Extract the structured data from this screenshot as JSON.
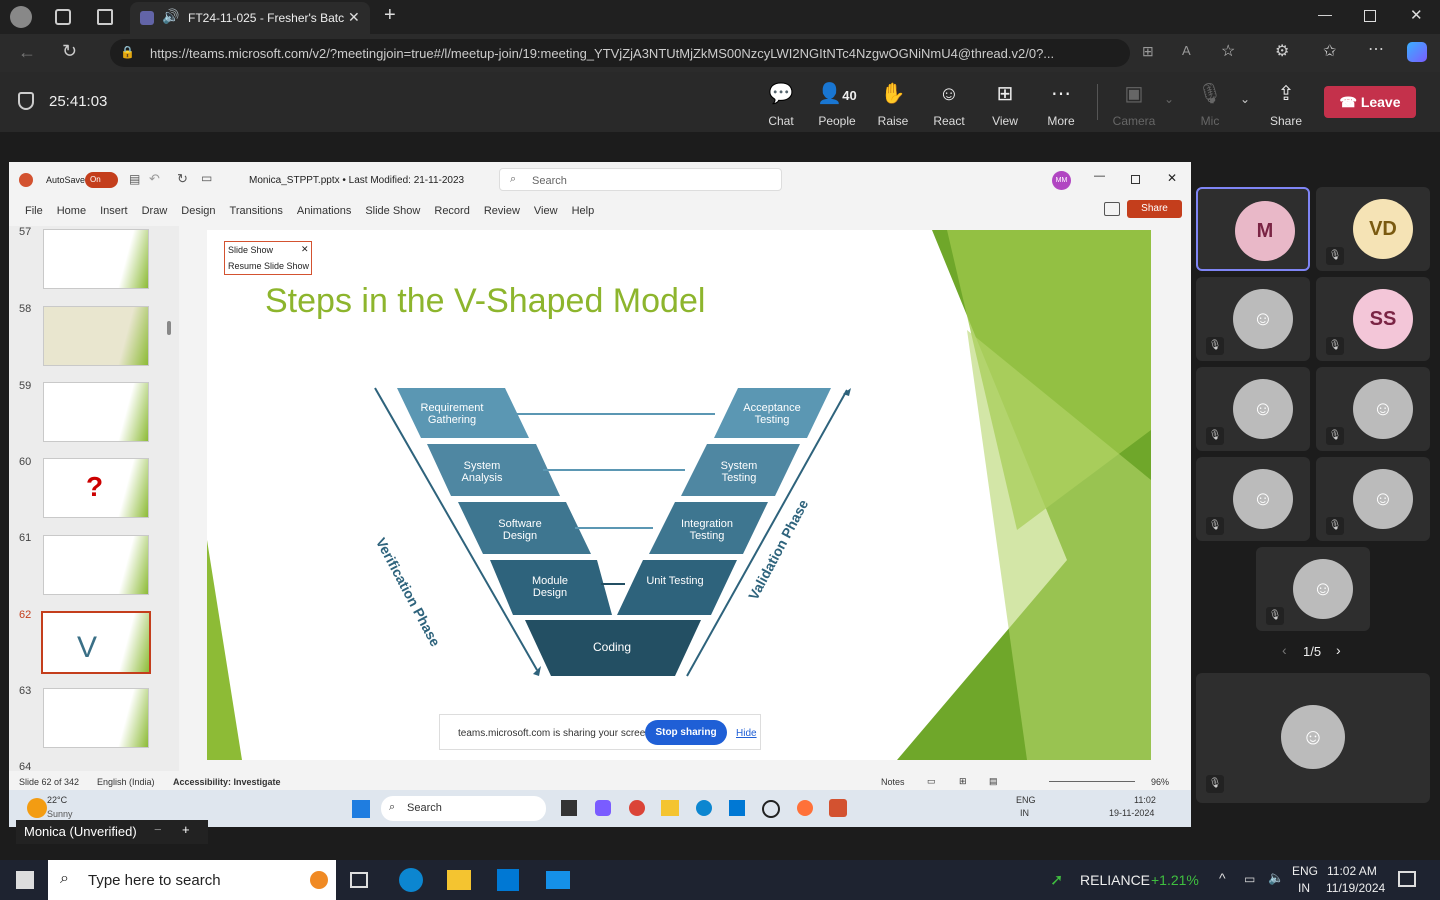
{
  "browser": {
    "tab_title": "FT24-11-025 - Fresher's Batc",
    "url": "https://teams.microsoft.com/v2/?meetingjoin=true#/l/meetup-join/19:meeting_YTVjZjA3NTUtMjZkMS00NzcyLWI2NGItNTc4NzgwOGNiNmU4@thread.v2/0?..."
  },
  "teams": {
    "timer": "25:41:03",
    "people_count": "40",
    "buttons": [
      "Chat",
      "People",
      "Raise",
      "React",
      "View",
      "More",
      "Camera",
      "Mic",
      "Share"
    ],
    "leave": "Leave"
  },
  "ppt": {
    "autosave": "AutoSave",
    "autosave_state": "On",
    "file": "Monica_STPPT.pptx • Last Modified: 21-11-2023",
    "search": "Search",
    "avatar": "MM",
    "share": "Share",
    "menu": [
      "File",
      "Home",
      "Insert",
      "Draw",
      "Design",
      "Transitions",
      "Animations",
      "Slide Show",
      "Record",
      "Review",
      "View",
      "Help"
    ],
    "thumb_numbers": [
      "57",
      "58",
      "59",
      "60",
      "61",
      "62",
      "63",
      "64"
    ],
    "slideshow_popup": {
      "title": "Slide Show",
      "resume": "Resume Slide Show"
    },
    "slide_title": "Steps in the V-Shaped Model",
    "left_levels": [
      "Requirement Gathering",
      "System Analysis",
      "Software Design",
      "Module Design"
    ],
    "right_levels": [
      "Acceptance Testing",
      "System Testing",
      "Integration Testing",
      "Unit Testing"
    ],
    "bottom": "Coding",
    "left_phase": "Verification Phase",
    "right_phase": "Validation Phase",
    "sharing_msg": "teams.microsoft.com is sharing your screen.",
    "stop_sharing": "Stop sharing",
    "hide": "Hide",
    "status": {
      "slide": "Slide 62 of 342",
      "lang": "English (India)",
      "access": "Accessibility: Investigate",
      "notes": "Notes",
      "zoom": "96%"
    },
    "inner_taskbar": {
      "temp": "22°C",
      "weather": "Sunny",
      "search": "Search",
      "lang1": "ENG",
      "lang2": "IN",
      "time": "11:02",
      "date": "19-11-2024"
    }
  },
  "presenter": "Monica (Unverified)",
  "participants": [
    {
      "initials": "M",
      "color": "#e9b8c8"
    },
    {
      "initials": "VD",
      "color": "#f5e3b5"
    },
    {
      "initials": "",
      "color": "#bbb"
    },
    {
      "initials": "SS",
      "color": "#f3c6d8"
    },
    {
      "initials": "",
      "color": "#bbb"
    },
    {
      "initials": "",
      "color": "#bbb"
    },
    {
      "initials": "",
      "color": "#bbb"
    },
    {
      "initials": "",
      "color": "#bbb"
    },
    {
      "initials": "",
      "color": "#bbb"
    }
  ],
  "pager": "1/5",
  "win_taskbar": {
    "search": "Type here to search",
    "stock": "RELIANCE",
    "change": "+1.21%",
    "lang1": "ENG",
    "lang2": "IN",
    "time": "11:02 AM",
    "date": "11/19/2024"
  }
}
